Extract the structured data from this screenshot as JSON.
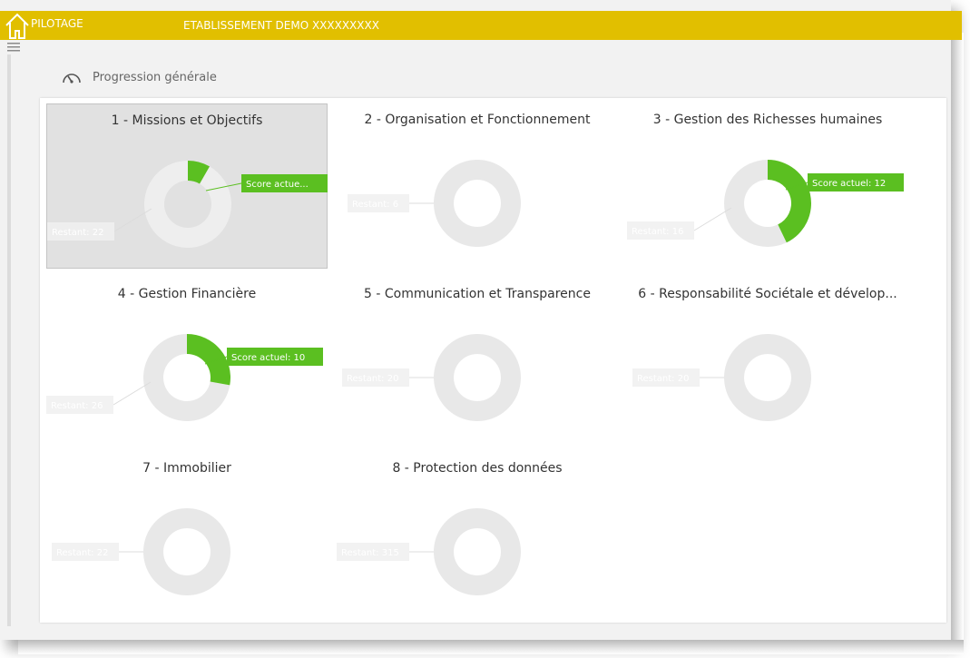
{
  "header": {
    "app_title": "PILOTAGE",
    "school_name": "ETABLISSEMENT DEMO XXXXXXXXX"
  },
  "section": {
    "title": "Progression générale",
    "icon": "gauge-icon"
  },
  "colors": {
    "topbar": "#e1bf00",
    "score": "#5bbf21",
    "remaining": "#e8e8e8",
    "selected_card": "#e1e1e1"
  },
  "chart_data": [
    {
      "type": "pie",
      "title": "1 - Missions et Objectifs",
      "selected": true,
      "series": [
        {
          "values": [
            2,
            22
          ],
          "labels": [
            "Score actue...",
            "Restant: 22"
          ]
        }
      ]
    },
    {
      "type": "pie",
      "title": "2 - Organisation et Fonctionnement",
      "series": [
        {
          "values": [
            0,
            6
          ],
          "labels": [
            "",
            "Restant: 6"
          ]
        }
      ]
    },
    {
      "type": "pie",
      "title": "3 - Gestion des Richesses humaines",
      "series": [
        {
          "values": [
            12,
            16
          ],
          "labels": [
            "Score actuel: 12",
            "Restant: 16"
          ]
        }
      ]
    },
    {
      "type": "pie",
      "title": "4 - Gestion Financière",
      "series": [
        {
          "values": [
            10,
            26
          ],
          "labels": [
            "Score actuel: 10",
            "Restant: 26"
          ]
        }
      ]
    },
    {
      "type": "pie",
      "title": "5 - Communication et Transparence",
      "series": [
        {
          "values": [
            0,
            20
          ],
          "labels": [
            "",
            "Restant: 20"
          ]
        }
      ]
    },
    {
      "type": "pie",
      "title": "6 - Responsabilité Sociétale et dévelop...",
      "series": [
        {
          "values": [
            0,
            20
          ],
          "labels": [
            "",
            "Restant: 20"
          ]
        }
      ]
    },
    {
      "type": "pie",
      "title": "7 - Immobilier",
      "series": [
        {
          "values": [
            0,
            22
          ],
          "labels": [
            "",
            "Restant: 22"
          ]
        }
      ]
    },
    {
      "type": "pie",
      "title": "8 - Protection des données",
      "series": [
        {
          "values": [
            0,
            315
          ],
          "labels": [
            "",
            "Restant: 315"
          ]
        }
      ]
    }
  ]
}
